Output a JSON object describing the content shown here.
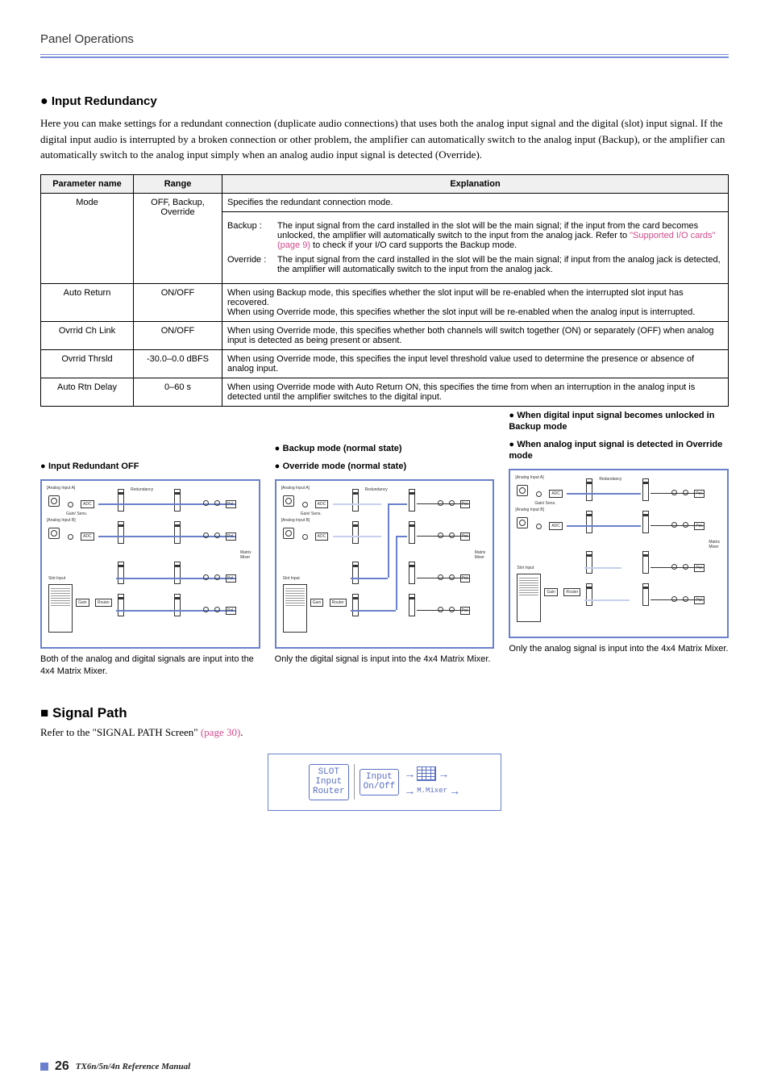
{
  "header": {
    "title": "Panel Operations"
  },
  "section": {
    "heading": "Input Redundancy",
    "intro": "Here you can make settings for a redundant connection (duplicate audio connections) that uses both the analog input signal and the digital (slot) input signal. If the digital input audio is interrupted by a broken connection or other problem, the amplifier can automatically switch to the analog input (Backup), or the amplifier can automatically switch to the analog input simply when an analog audio input signal is detected (Override)."
  },
  "table": {
    "headers": {
      "param": "Parameter name",
      "range": "Range",
      "explanation": "Explanation"
    },
    "rows": {
      "mode": {
        "name": "Mode",
        "range": "OFF, Backup, Override",
        "expl_top": "Specifies the redundant connection mode.",
        "backup_label": "Backup :",
        "backup_text_1": "The input signal from the card installed in the slot will be the main signal; if the input from the card becomes unlocked, the amplifier will automatically switch to the input from the analog jack. Refer to ",
        "backup_link": "\"Supported I/O cards\" (page 9)",
        "backup_text_2": " to check if your I/O card supports the Backup mode.",
        "override_label": "Override :",
        "override_text": "The input signal from the card installed in the slot will be the main signal; if input from the analog jack is detected, the amplifier will automatically switch to the input from the analog jack."
      },
      "auto_return": {
        "name": "Auto Return",
        "range": "ON/OFF",
        "expl": "When using Backup mode, this specifies whether the slot input will be re-enabled when the interrupted slot input has recovered.\nWhen using Override mode, this specifies whether the slot input will be re-enabled when the analog input is interrupted."
      },
      "ovrrid_ch_link": {
        "name": "Ovrrid Ch Link",
        "range": "ON/OFF",
        "expl": "When using Override mode, this specifies whether both channels will switch together (ON) or separately (OFF) when analog input is detected as being present or absent."
      },
      "ovrrid_thrsld": {
        "name": "Ovrrid Thrsld",
        "range": "-30.0–0.0 dBFS",
        "expl": "When using Override mode, this specifies the input level threshold value used to determine the presence or absence of analog input."
      },
      "auto_rtn_delay": {
        "name": "Auto Rtn Delay",
        "range": "0–60 s",
        "expl": "When using Override mode with Auto Return ON, this specifies the time from when an interruption in the analog input is detected until the amplifier switches to the digital input."
      }
    }
  },
  "diagrams": {
    "col1": {
      "sub": "Input Redundant OFF",
      "caption": "Both of the analog and digital signals are input into the 4x4 Matrix Mixer."
    },
    "col2": {
      "sub1": "Backup mode (normal state)",
      "sub2": "Override mode (normal state)",
      "caption": "Only the digital signal is input into the 4x4 Matrix Mixer."
    },
    "col3": {
      "sub1": "When digital input signal becomes unlocked in Backup mode",
      "sub2": "When analog input signal is detected in Override mode",
      "caption": "Only the analog signal is input into the 4x4 Matrix Mixer."
    },
    "labels": {
      "analog_a": "[Analog Input A]",
      "analog_b": "[Analog Input B]",
      "gain_sens": "Gain/ Sens.",
      "adc": "ADC",
      "redundancy": "Redundancy",
      "pol": "Pol.",
      "matrix_mixer": "Matrix Mixer",
      "slot_input": "Slot Input",
      "gain": "Gain",
      "router": "Router"
    }
  },
  "signal_path": {
    "heading": "Signal Path",
    "text_prefix": "Refer to the \"SIGNAL PATH Screen\" ",
    "link": "(page 30)",
    "text_suffix": ".",
    "screen": {
      "slot": "SLOT\nInput\nRouter",
      "input": "Input\nOn/Off",
      "mixer": "M.Mixer"
    }
  },
  "footer": {
    "page": "26",
    "ref": "TX6n/5n/4n  Reference Manual"
  }
}
